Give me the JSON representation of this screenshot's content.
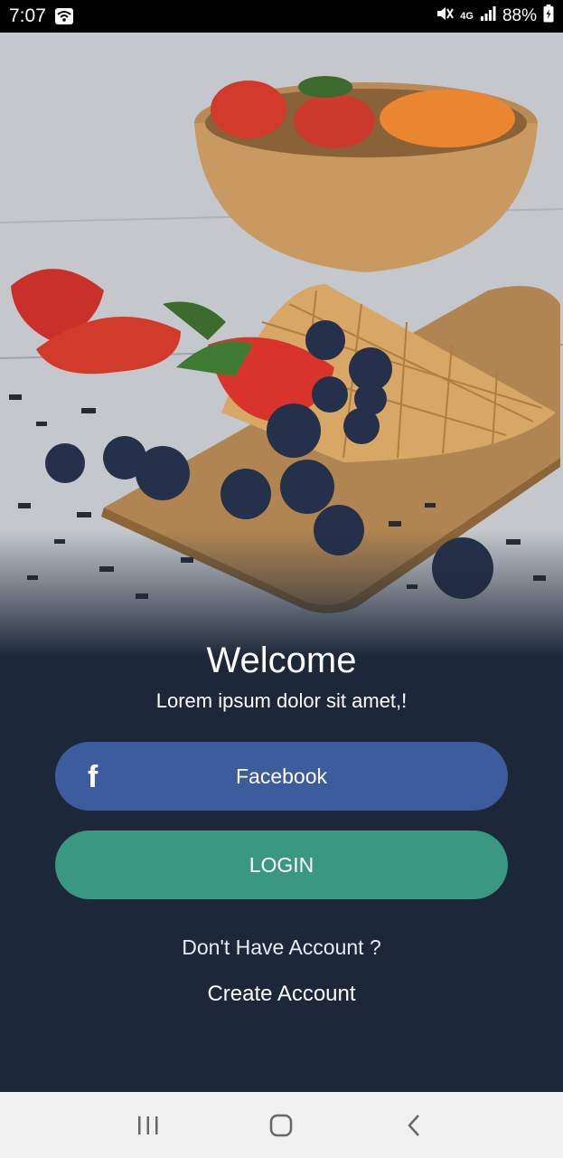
{
  "status_bar": {
    "time": "7:07",
    "network": "4G",
    "battery": "88%"
  },
  "hero": {
    "image_icon": "food-photo"
  },
  "welcome": {
    "title": "Welcome",
    "subtitle": "Lorem ipsum dolor sit amet,!"
  },
  "buttons": {
    "facebook_label": "Facebook",
    "facebook_icon": "f",
    "login_label": "LOGIN"
  },
  "account": {
    "question": "Don't Have Account ?",
    "create_label": "Create Account"
  },
  "colors": {
    "background": "#1c283a",
    "facebook": "#3d5c9e",
    "login": "#3a9882"
  }
}
